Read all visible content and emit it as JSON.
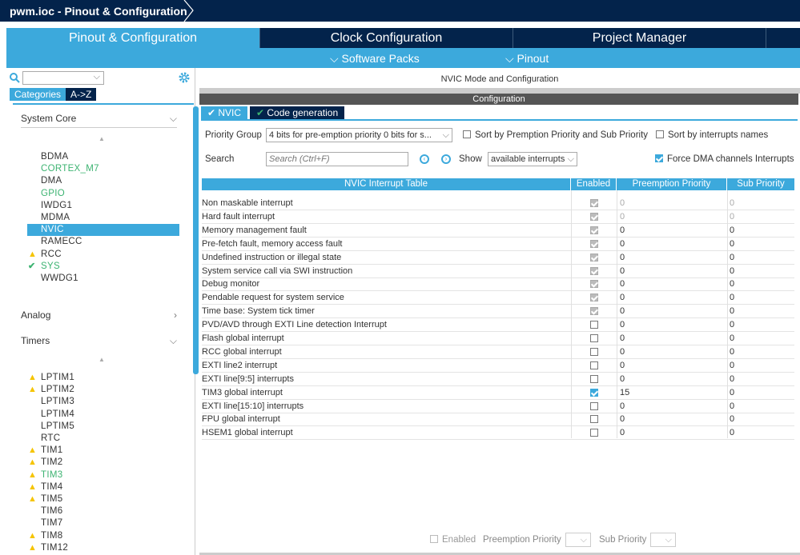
{
  "window": {
    "title": "pwm.ioc - Pinout & Configuration"
  },
  "tabs": [
    {
      "label": "Pinout & Configuration",
      "active": true
    },
    {
      "label": "Clock Configuration"
    },
    {
      "label": "Project Manager"
    }
  ],
  "subtabs": [
    {
      "label": "Software Packs",
      "icon": "chevron-down-icon"
    },
    {
      "label": "Pinout",
      "icon": "chevron-down-icon"
    }
  ],
  "sidebar": {
    "search_value": "",
    "view_tabs": [
      {
        "label": "Categories",
        "active": true
      },
      {
        "label": "A->Z"
      }
    ],
    "sections": [
      {
        "label": "System Core",
        "expanded": true,
        "items": [
          {
            "label": "BDMA"
          },
          {
            "label": "CORTEX_M7",
            "status": "configured"
          },
          {
            "label": "DMA"
          },
          {
            "label": "GPIO",
            "status": "configured"
          },
          {
            "label": "IWDG1"
          },
          {
            "label": "MDMA"
          },
          {
            "label": "NVIC",
            "selected": true
          },
          {
            "label": "RAMECC"
          },
          {
            "label": "RCC",
            "status": "warning"
          },
          {
            "label": "SYS",
            "status": "ok"
          },
          {
            "label": "WWDG1"
          }
        ]
      },
      {
        "label": "Analog",
        "expanded": false,
        "items": []
      },
      {
        "label": "Timers",
        "expanded": true,
        "items": [
          {
            "label": "LPTIM1",
            "status": "warning"
          },
          {
            "label": "LPTIM2",
            "status": "warning"
          },
          {
            "label": "LPTIM3"
          },
          {
            "label": "LPTIM4"
          },
          {
            "label": "LPTIM5"
          },
          {
            "label": "RTC"
          },
          {
            "label": "TIM1",
            "status": "warning"
          },
          {
            "label": "TIM2",
            "status": "warning"
          },
          {
            "label": "TIM3",
            "status": "warning-configured"
          },
          {
            "label": "TIM4",
            "status": "warning"
          },
          {
            "label": "TIM5",
            "status": "warning"
          },
          {
            "label": "TIM6"
          },
          {
            "label": "TIM7"
          },
          {
            "label": "TIM8",
            "status": "warning"
          },
          {
            "label": "TIM12",
            "status": "warning"
          }
        ]
      }
    ]
  },
  "main": {
    "mode_title": "NVIC Mode and Configuration",
    "config_title": "Configuration",
    "tabs": [
      {
        "label": "NVIC",
        "active": true
      },
      {
        "label": "Code generation"
      }
    ],
    "priority_group_label": "Priority Group",
    "priority_group_value": "4 bits for pre-emption priority 0 bits for s...",
    "sort_premption_label": "Sort by Premption Priority and Sub Priority",
    "sort_premption_checked": false,
    "sort_names_label": "Sort by interrupts names",
    "sort_names_checked": false,
    "search_label": "Search",
    "search_placeholder": "Search (Ctrl+F)",
    "show_label": "Show",
    "show_value": "available interrupts",
    "force_dma_label": "Force DMA channels Interrupts",
    "force_dma_checked": true,
    "table": {
      "headers": [
        "NVIC Interrupt Table",
        "Enabled",
        "Preemption Priority",
        "Sub Priority"
      ],
      "rows": [
        {
          "name": "Non maskable interrupt",
          "enabled": true,
          "locked": true,
          "pre": "0",
          "sub": "0",
          "dim": true
        },
        {
          "name": "Hard fault interrupt",
          "enabled": true,
          "locked": true,
          "pre": "0",
          "sub": "0",
          "dim": true
        },
        {
          "name": "Memory management fault",
          "enabled": true,
          "locked": true,
          "pre": "0",
          "sub": "0"
        },
        {
          "name": "Pre-fetch fault, memory access fault",
          "enabled": true,
          "locked": true,
          "pre": "0",
          "sub": "0"
        },
        {
          "name": "Undefined instruction or illegal state",
          "enabled": true,
          "locked": true,
          "pre": "0",
          "sub": "0"
        },
        {
          "name": "System service call via SWI instruction",
          "enabled": true,
          "locked": true,
          "pre": "0",
          "sub": "0"
        },
        {
          "name": "Debug monitor",
          "enabled": true,
          "locked": true,
          "pre": "0",
          "sub": "0"
        },
        {
          "name": "Pendable request for system service",
          "enabled": true,
          "locked": true,
          "pre": "0",
          "sub": "0"
        },
        {
          "name": "Time base: System tick timer",
          "enabled": true,
          "locked": true,
          "pre": "0",
          "sub": "0"
        },
        {
          "name": "PVD/AVD through EXTI Line detection Interrupt",
          "enabled": false,
          "pre": "0",
          "sub": "0"
        },
        {
          "name": "Flash global interrupt",
          "enabled": false,
          "pre": "0",
          "sub": "0"
        },
        {
          "name": "RCC global interrupt",
          "enabled": false,
          "pre": "0",
          "sub": "0"
        },
        {
          "name": "EXTI line2 interrupt",
          "enabled": false,
          "pre": "0",
          "sub": "0"
        },
        {
          "name": "EXTI line[9:5] interrupts",
          "enabled": false,
          "pre": "0",
          "sub": "0"
        },
        {
          "name": "TIM3 global interrupt",
          "enabled": true,
          "pre": "15",
          "sub": "0"
        },
        {
          "name": "EXTI line[15:10] interrupts",
          "enabled": false,
          "pre": "0",
          "sub": "0"
        },
        {
          "name": "FPU global interrupt",
          "enabled": false,
          "pre": "0",
          "sub": "0"
        },
        {
          "name": "HSEM1 global interrupt",
          "enabled": false,
          "pre": "0",
          "sub": "0"
        }
      ]
    },
    "footer": {
      "enabled_label": "Enabled",
      "preemption_label": "Preemption Priority",
      "sub_label": "Sub Priority"
    }
  },
  "colors": {
    "navy": "#03234b",
    "accent": "#3ca9dc",
    "green": "#3cb371",
    "warning": "#f5c400"
  }
}
